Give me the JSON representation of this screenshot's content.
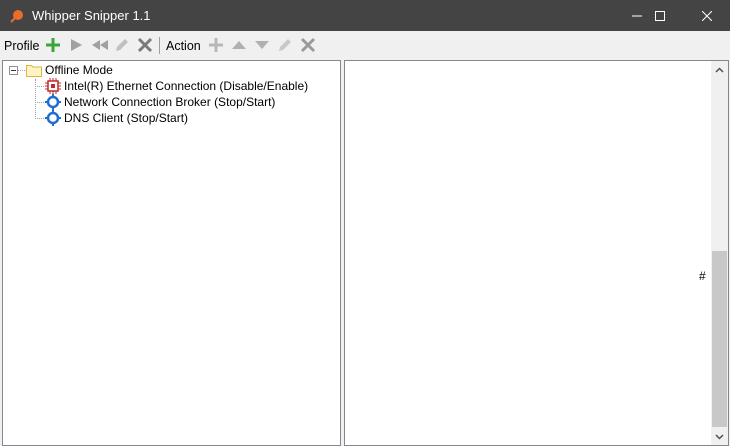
{
  "window": {
    "title": "Whipper Snipper 1.1",
    "accent": "#e86c2c"
  },
  "toolbar": {
    "profile_label": "Profile",
    "action_label": "Action",
    "colors": {
      "add_enabled": "#3aa63a",
      "disabled": "#a0a0a0",
      "delete": "#7a7a7a"
    }
  },
  "tree": {
    "root": {
      "label": "Offline Mode",
      "icon": "folder-icon"
    },
    "items": [
      {
        "label": "Intel(R) Ethernet Connection (Disable/Enable)",
        "icon": "network-adapter-icon"
      },
      {
        "label": "Network Connection Broker (Stop/Start)",
        "icon": "service-gear-icon"
      },
      {
        "label": "DNS Client (Stop/Start)",
        "icon": "service-gear-icon"
      }
    ]
  },
  "log": {
    "marker": "#"
  }
}
